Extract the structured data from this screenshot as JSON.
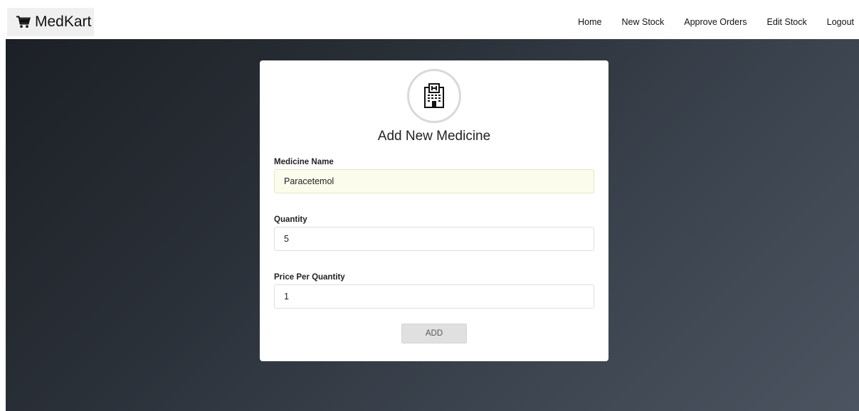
{
  "navbar": {
    "brand": "MedKart",
    "links": [
      "Home",
      "New Stock",
      "Approve Orders",
      "Edit Stock",
      "Logout"
    ]
  },
  "form": {
    "title": "Add New Medicine",
    "medicine_name_label": "Medicine Name",
    "medicine_name_value": "Paracetemol",
    "quantity_label": "Quantity",
    "quantity_value": "5",
    "price_label": "Price Per Quantity",
    "price_value": "1",
    "submit_label": "ADD"
  },
  "icons": {
    "brand": "shopping-cart-icon",
    "form_header": "hospital-icon"
  }
}
